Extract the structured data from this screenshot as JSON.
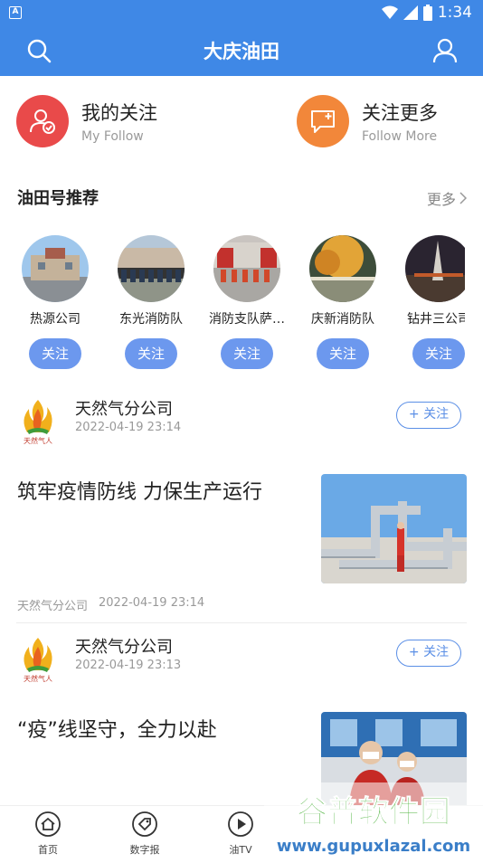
{
  "status": {
    "time": "1:34",
    "indicator": "A"
  },
  "appbar": {
    "title": "大庆油田"
  },
  "follow": {
    "mine": {
      "title": "我的关注",
      "subtitle": "My Follow",
      "color": "#e94a4a"
    },
    "more": {
      "title": "关注更多",
      "subtitle": "Follow  More",
      "color": "#f2873a"
    }
  },
  "recommend": {
    "title": "油田号推荐",
    "more": "更多",
    "items": [
      {
        "name": "热源公司",
        "button": "关注"
      },
      {
        "name": "东光消防队",
        "button": "关注"
      },
      {
        "name": "消防支队萨…",
        "button": "关注"
      },
      {
        "name": "庆新消防队",
        "button": "关注"
      },
      {
        "name": "钻井三公司",
        "button": "关注"
      }
    ]
  },
  "posts": [
    {
      "source": "天然气分公司",
      "source_time": "2022-04-19 23:14",
      "follow_label": "+ 关注",
      "headline": "筑牢疫情防线 力保生产运行",
      "meta_source": "天然气分公司",
      "meta_time": "2022-04-19 23:14"
    },
    {
      "source": "天然气分公司",
      "source_time": "2022-04-19 23:13",
      "follow_label": "+ 关注",
      "headline": "“疫”线坚守，全力以赴"
    }
  ],
  "logo_text": "天然气人",
  "tabs": [
    {
      "label": "首页",
      "icon": "home-icon"
    },
    {
      "label": "数字报",
      "icon": "tag-icon"
    },
    {
      "label": "油TV",
      "icon": "play-icon"
    }
  ],
  "watermark": {
    "title": "谷普软件园",
    "url": "www.gupuxlazal.com"
  },
  "colors": {
    "accent": "#3f88e6",
    "follow_button": "#6c98ee"
  }
}
